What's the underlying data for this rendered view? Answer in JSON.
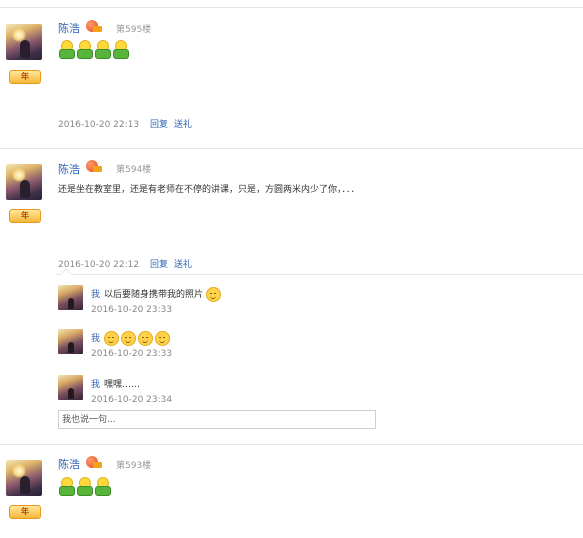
{
  "posts": [
    {
      "username": "陈浩",
      "badge": "年",
      "floor": "第595楼",
      "emoji_count": 4,
      "date": "2016-10-20 22:13",
      "reply_label": "回复",
      "gift_label": "送礼"
    },
    {
      "username": "陈浩",
      "badge": "年",
      "floor": "第594楼",
      "content": "还是坐在教室里，还是有老师在不停的讲课，只是，方圆两米内少了你，．．．",
      "date": "2016-10-20 22:12",
      "reply_label": "回复",
      "gift_label": "送礼",
      "replies": [
        {
          "who": "我",
          "text": "以后要随身携带我的照片",
          "date": "2016-10-20 23:33",
          "faces": 1
        },
        {
          "who": "我",
          "text": "",
          "date": "2016-10-20 23:33",
          "faces": 4
        },
        {
          "who": "我",
          "text": "嘿嘿……",
          "date": "2016-10-20 23:34",
          "faces": 0
        }
      ],
      "reply_input_placeholder": "我也说一句..."
    },
    {
      "username": "陈浩",
      "badge": "年",
      "floor": "第593楼",
      "emoji_count": 3
    }
  ]
}
